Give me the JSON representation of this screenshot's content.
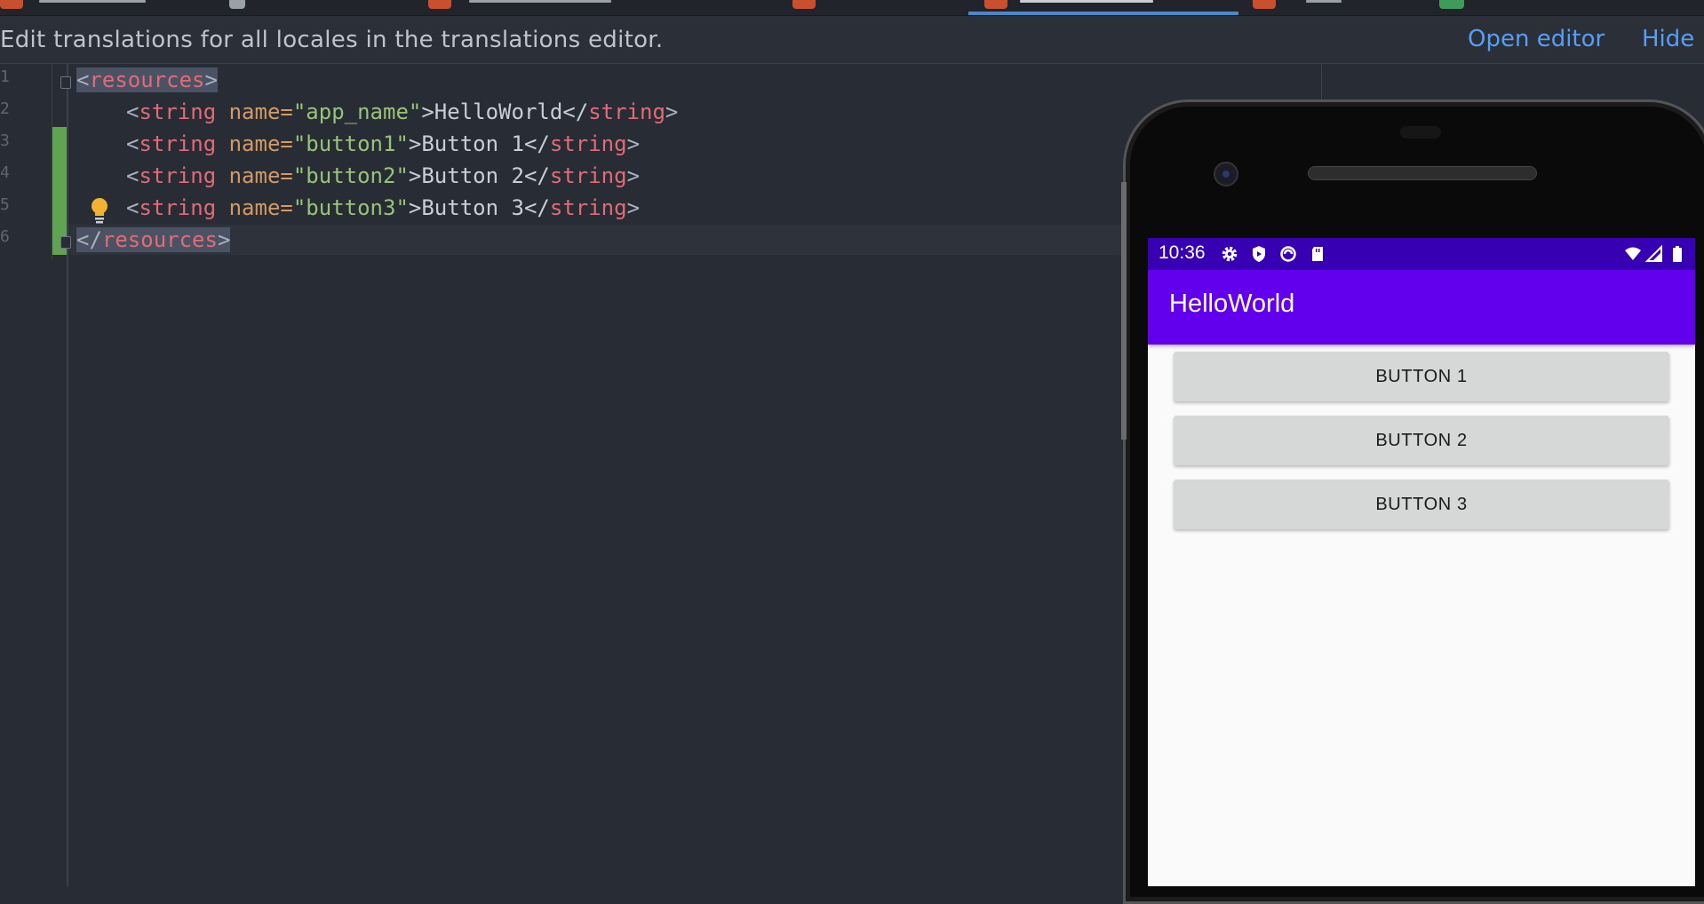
{
  "notification": {
    "message": "Edit translations for all locales in the translations editor.",
    "open_editor": "Open editor",
    "hide": "Hide"
  },
  "editor": {
    "lines": [
      {
        "tokens": [
          {
            "t": "<",
            "c": "br"
          },
          {
            "t": "resources",
            "c": "tag"
          },
          {
            "t": ">",
            "c": "br"
          }
        ]
      },
      {
        "tokens": [
          {
            "t": "<",
            "c": "br"
          },
          {
            "t": "string",
            "c": "tag"
          },
          {
            "t": " name=",
            "c": "attr"
          },
          {
            "t": "\"app_name\"",
            "c": "val"
          },
          {
            "t": ">HelloWorld</",
            "c": "txt"
          },
          {
            "t": "string",
            "c": "tag"
          },
          {
            "t": ">",
            "c": "br"
          }
        ]
      },
      {
        "tokens": [
          {
            "t": "<",
            "c": "br"
          },
          {
            "t": "string",
            "c": "tag"
          },
          {
            "t": " name=",
            "c": "attr"
          },
          {
            "t": "\"button1\"",
            "c": "val"
          },
          {
            "t": ">Button 1</",
            "c": "txt"
          },
          {
            "t": "string",
            "c": "tag"
          },
          {
            "t": ">",
            "c": "br"
          }
        ]
      },
      {
        "tokens": [
          {
            "t": "<",
            "c": "br"
          },
          {
            "t": "string",
            "c": "tag"
          },
          {
            "t": " name=",
            "c": "attr"
          },
          {
            "t": "\"button2\"",
            "c": "val"
          },
          {
            "t": ">Button 2</",
            "c": "txt"
          },
          {
            "t": "string",
            "c": "tag"
          },
          {
            "t": ">",
            "c": "br"
          }
        ]
      },
      {
        "tokens": [
          {
            "t": "<",
            "c": "br"
          },
          {
            "t": "string",
            "c": "tag"
          },
          {
            "t": " name=",
            "c": "attr"
          },
          {
            "t": "\"button3\"",
            "c": "val"
          },
          {
            "t": ">Button 3</",
            "c": "txt"
          },
          {
            "t": "string",
            "c": "tag"
          },
          {
            "t": ">",
            "c": "br"
          }
        ]
      },
      {
        "tokens": [
          {
            "t": "</",
            "c": "br"
          },
          {
            "t": "resources",
            "c": "tag"
          },
          {
            "t": ">",
            "c": "br"
          }
        ]
      }
    ],
    "intention_icon": "lightbulb-icon"
  },
  "device": {
    "status_time": "10:36",
    "status_icons_left": [
      "settings-icon",
      "shield-icon",
      "data-saver-icon",
      "sd-card-icon"
    ],
    "status_icons_right": [
      "wifi-icon",
      "signal-icon",
      "battery-icon"
    ],
    "app_title": "HelloWorld",
    "buttons": [
      "BUTTON 1",
      "BUTTON 2",
      "BUTTON 3"
    ],
    "colors": {
      "status_bar": "#3700b3",
      "app_bar": "#6200ee",
      "button": "#d6d7d7"
    }
  }
}
